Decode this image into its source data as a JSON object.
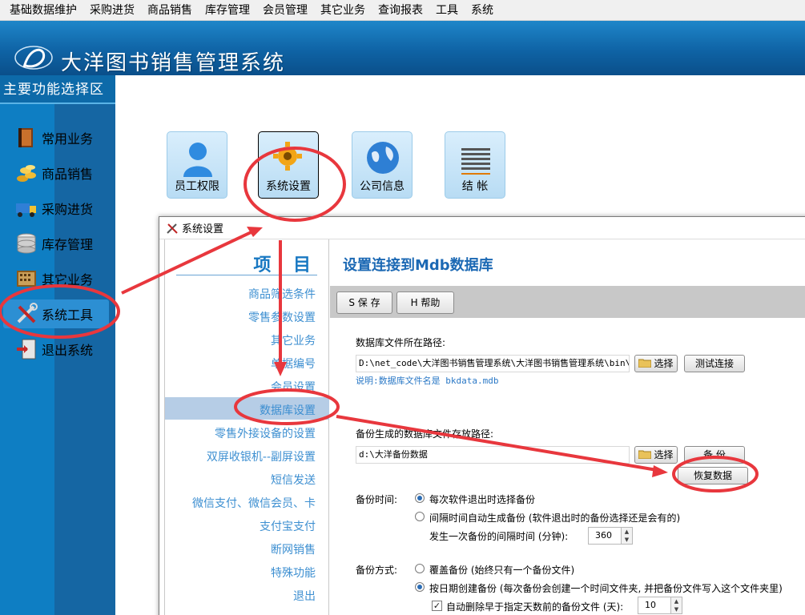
{
  "menubar": [
    "基础数据维护",
    "采购进货",
    "商品销售",
    "库存管理",
    "会员管理",
    "其它业务",
    "查询报表",
    "工具",
    "系统"
  ],
  "banner": {
    "title": "大洋图书销售管理系统"
  },
  "sidebar": {
    "header": "主要功能选择区",
    "items": [
      {
        "label": "常用业务",
        "icon": "book-icon"
      },
      {
        "label": "商品销售",
        "icon": "coins-icon"
      },
      {
        "label": "采购进货",
        "icon": "truck-icon"
      },
      {
        "label": "库存管理",
        "icon": "database-icon"
      },
      {
        "label": "其它业务",
        "icon": "calculator-icon"
      },
      {
        "label": "系统工具",
        "icon": "tools-icon"
      },
      {
        "label": "退出系统",
        "icon": "exit-icon"
      }
    ],
    "active": "系统工具"
  },
  "functions": [
    {
      "label": "员工权限",
      "icon": "user-icon"
    },
    {
      "label": "系统设置",
      "icon": "gear-icon"
    },
    {
      "label": "公司信息",
      "icon": "globe-icon"
    },
    {
      "label": "结  帐",
      "icon": "ledger-icon"
    }
  ],
  "dialog": {
    "title": "系统设置",
    "left": {
      "heading": "项  目",
      "items": [
        "商品筛选条件",
        "零售参数设置",
        "其它业务",
        "单据编号",
        "会员设置",
        "数据库设置",
        "零售外接设备的设置",
        "双屏收银机--副屏设置",
        "短信发送",
        "微信支付、微信会员、卡",
        "支付宝支付",
        "断网销售",
        "特殊功能",
        "退出"
      ],
      "selected": "数据库设置"
    },
    "right": {
      "title": "设置连接到Mdb数据库",
      "save_button": "S 保 存",
      "help_button": "H 帮助",
      "db_path_label": "数据库文件所在路径:",
      "db_path_value": "D:\\net_code\\大洋图书销售管理系统\\大洋图书销售管理系统\\bin\\Debug",
      "choose_button": "选择",
      "test_button": "测试连接",
      "db_note": "说明:数据库文件名是 bkdata.mdb",
      "backup_path_label": "备份生成的数据库文件存放路径:",
      "backup_path_value": "d:\\大洋备份数据",
      "choose_button2": "选择",
      "backup_button": "备 份",
      "restore_button": "恢复数据",
      "backup_time_label": "备份时间:",
      "time_opt1": "每次软件退出时选择备份",
      "time_opt2": "间隔时间自动生成备份 (软件退出时的备份选择还是会有的)",
      "interval_label": "发生一次备份的间隔时间 (分钟):",
      "interval_value": "360",
      "backup_mode_label": "备份方式:",
      "mode_opt1": "覆盖备份 (始终只有一个备份文件)",
      "mode_opt2": "按日期创建备份 (每次备份会创建一个时间文件夹, 并把备份文件写入这个文件夹里)",
      "auto_delete_label": "自动删除早于指定天数前的备份文件 (天):",
      "auto_delete_value": "10"
    }
  },
  "colors": {
    "accent": "#1c69b4",
    "sidebar": "#0e7ec3",
    "annotation": "#e8373d"
  }
}
